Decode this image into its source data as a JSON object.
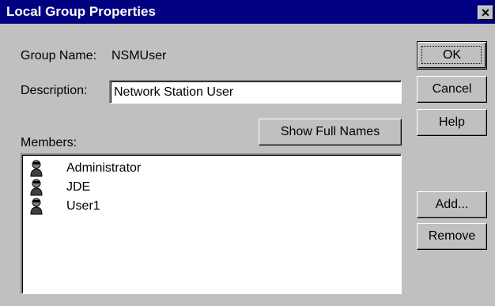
{
  "window": {
    "title": "Local Group Properties",
    "close_glyph": "✕"
  },
  "group_name": {
    "label": "Group Name:",
    "value": "NSMUser"
  },
  "description": {
    "label": "Description:",
    "value": "Network Station User"
  },
  "members": {
    "label": "Members:",
    "items": [
      {
        "label": "Administrator",
        "icon": "user-icon"
      },
      {
        "label": "JDE",
        "icon": "user-icon"
      },
      {
        "label": "User1",
        "icon": "user-icon"
      }
    ]
  },
  "buttons": {
    "ok": "OK",
    "cancel": "Cancel",
    "help": "Help",
    "show_full_names": "Show Full Names",
    "add": "Add...",
    "remove": "Remove"
  }
}
